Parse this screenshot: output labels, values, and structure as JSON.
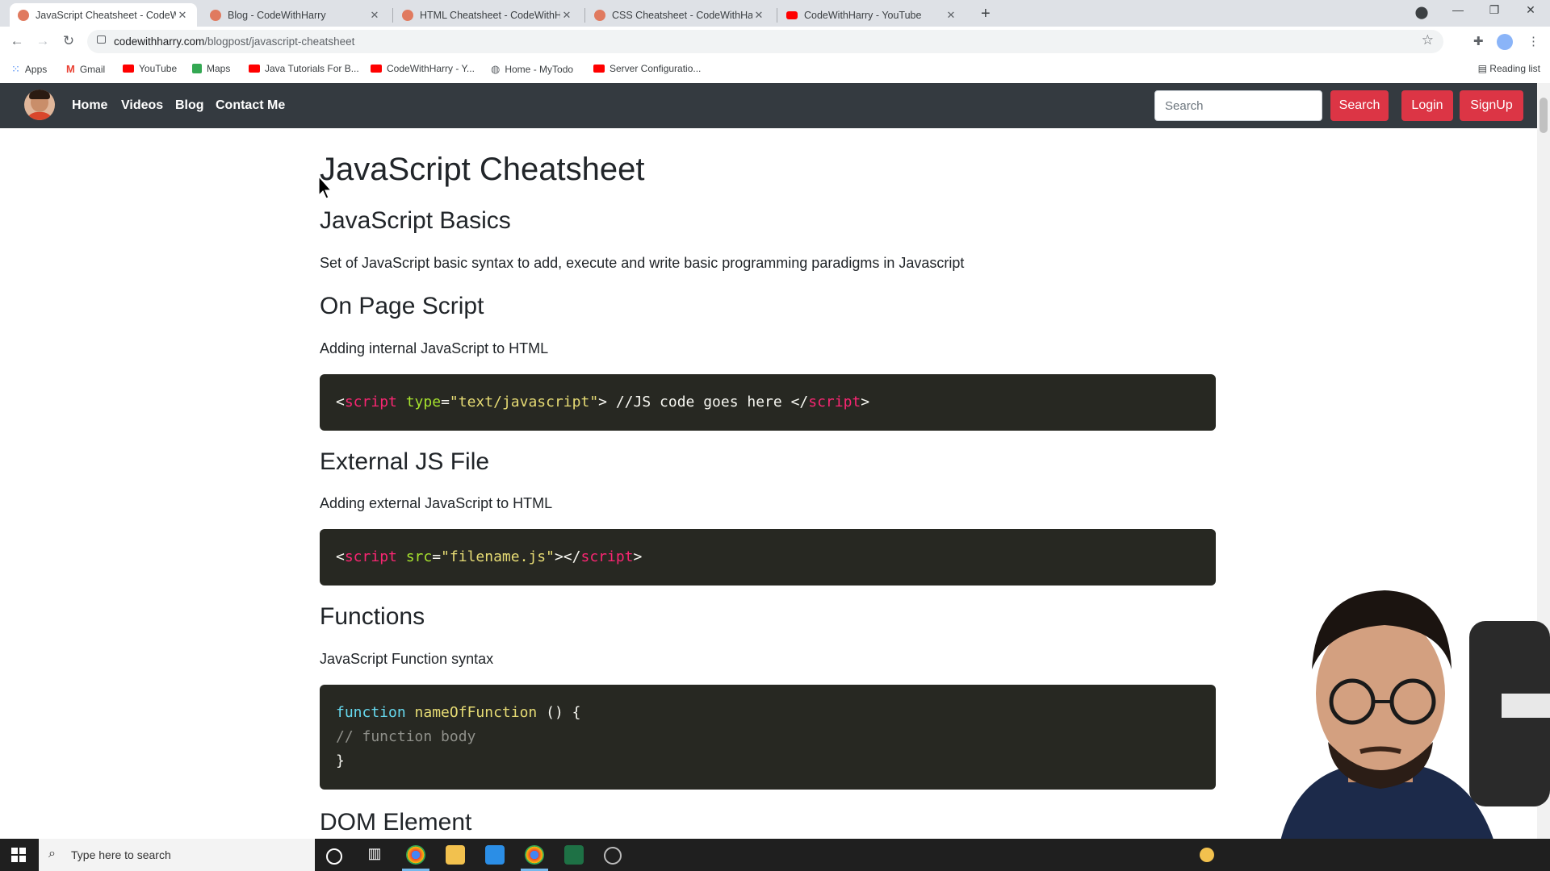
{
  "browser": {
    "tabs": [
      {
        "title": "JavaScript Cheatsheet - CodeWit",
        "active": true
      },
      {
        "title": "Blog - CodeWithHarry",
        "active": false
      },
      {
        "title": "HTML Cheatsheet - CodeWithHa",
        "active": false
      },
      {
        "title": "CSS Cheatsheet - CodeWithHarry",
        "active": false
      },
      {
        "title": "CodeWithHarry - YouTube",
        "active": false
      }
    ],
    "url_host": "codewithharry.com",
    "url_path": "/blogpost/javascript-cheatsheet",
    "bookmarks": [
      "Apps",
      "Gmail",
      "YouTube",
      "Maps",
      "Java Tutorials For B...",
      "CodeWithHarry - Y...",
      "Home - MyTodo",
      "Server Configuratio..."
    ],
    "reading_list": "Reading list"
  },
  "site": {
    "nav": [
      "Home",
      "Videos",
      "Blog",
      "Contact Me"
    ],
    "search_placeholder": "Search",
    "search_button": "Search",
    "login_button": "Login",
    "signup_button": "SignUp"
  },
  "article": {
    "title": "JavaScript Cheatsheet",
    "basics_heading": "JavaScript Basics",
    "basics_desc": "Set of JavaScript basic syntax to add, execute and write basic programming paradigms in Javascript",
    "onpage_heading": "On Page Script",
    "onpage_desc": "Adding internal JavaScript to HTML",
    "external_heading": "External JS File",
    "external_desc": "Adding external JavaScript to HTML",
    "functions_heading": "Functions",
    "functions_desc": "JavaScript Function syntax",
    "dom_heading": "DOM Element"
  },
  "code": {
    "onpage": {
      "lt": "<",
      "tag": "script",
      "attr": "type",
      "eq": "=",
      "val": "\"text/javascript\"",
      "mid": "> //JS code goes here </",
      "tag2": "script",
      "gt": ">"
    },
    "external": {
      "lt": "<",
      "tag": "script",
      "attr": "src",
      "eq": "=",
      "val": "\"filename.js\"",
      "mid": "></",
      "tag2": "script",
      "gt": ">"
    },
    "functions": {
      "kw": "function",
      "name": "nameOfFunction",
      "rest": " () {",
      "comment": "// function body",
      "close": "}"
    }
  },
  "taskbar": {
    "search_placeholder": "Type here to search"
  },
  "colors": {
    "navbar": "#343a40",
    "button_red": "#dc3545",
    "code_bg": "#272822",
    "code_tag": "#f92672",
    "code_attr": "#a6e22e",
    "code_string": "#e6db74",
    "code_keyword": "#66d9ef",
    "code_comment": "#8f908a"
  }
}
